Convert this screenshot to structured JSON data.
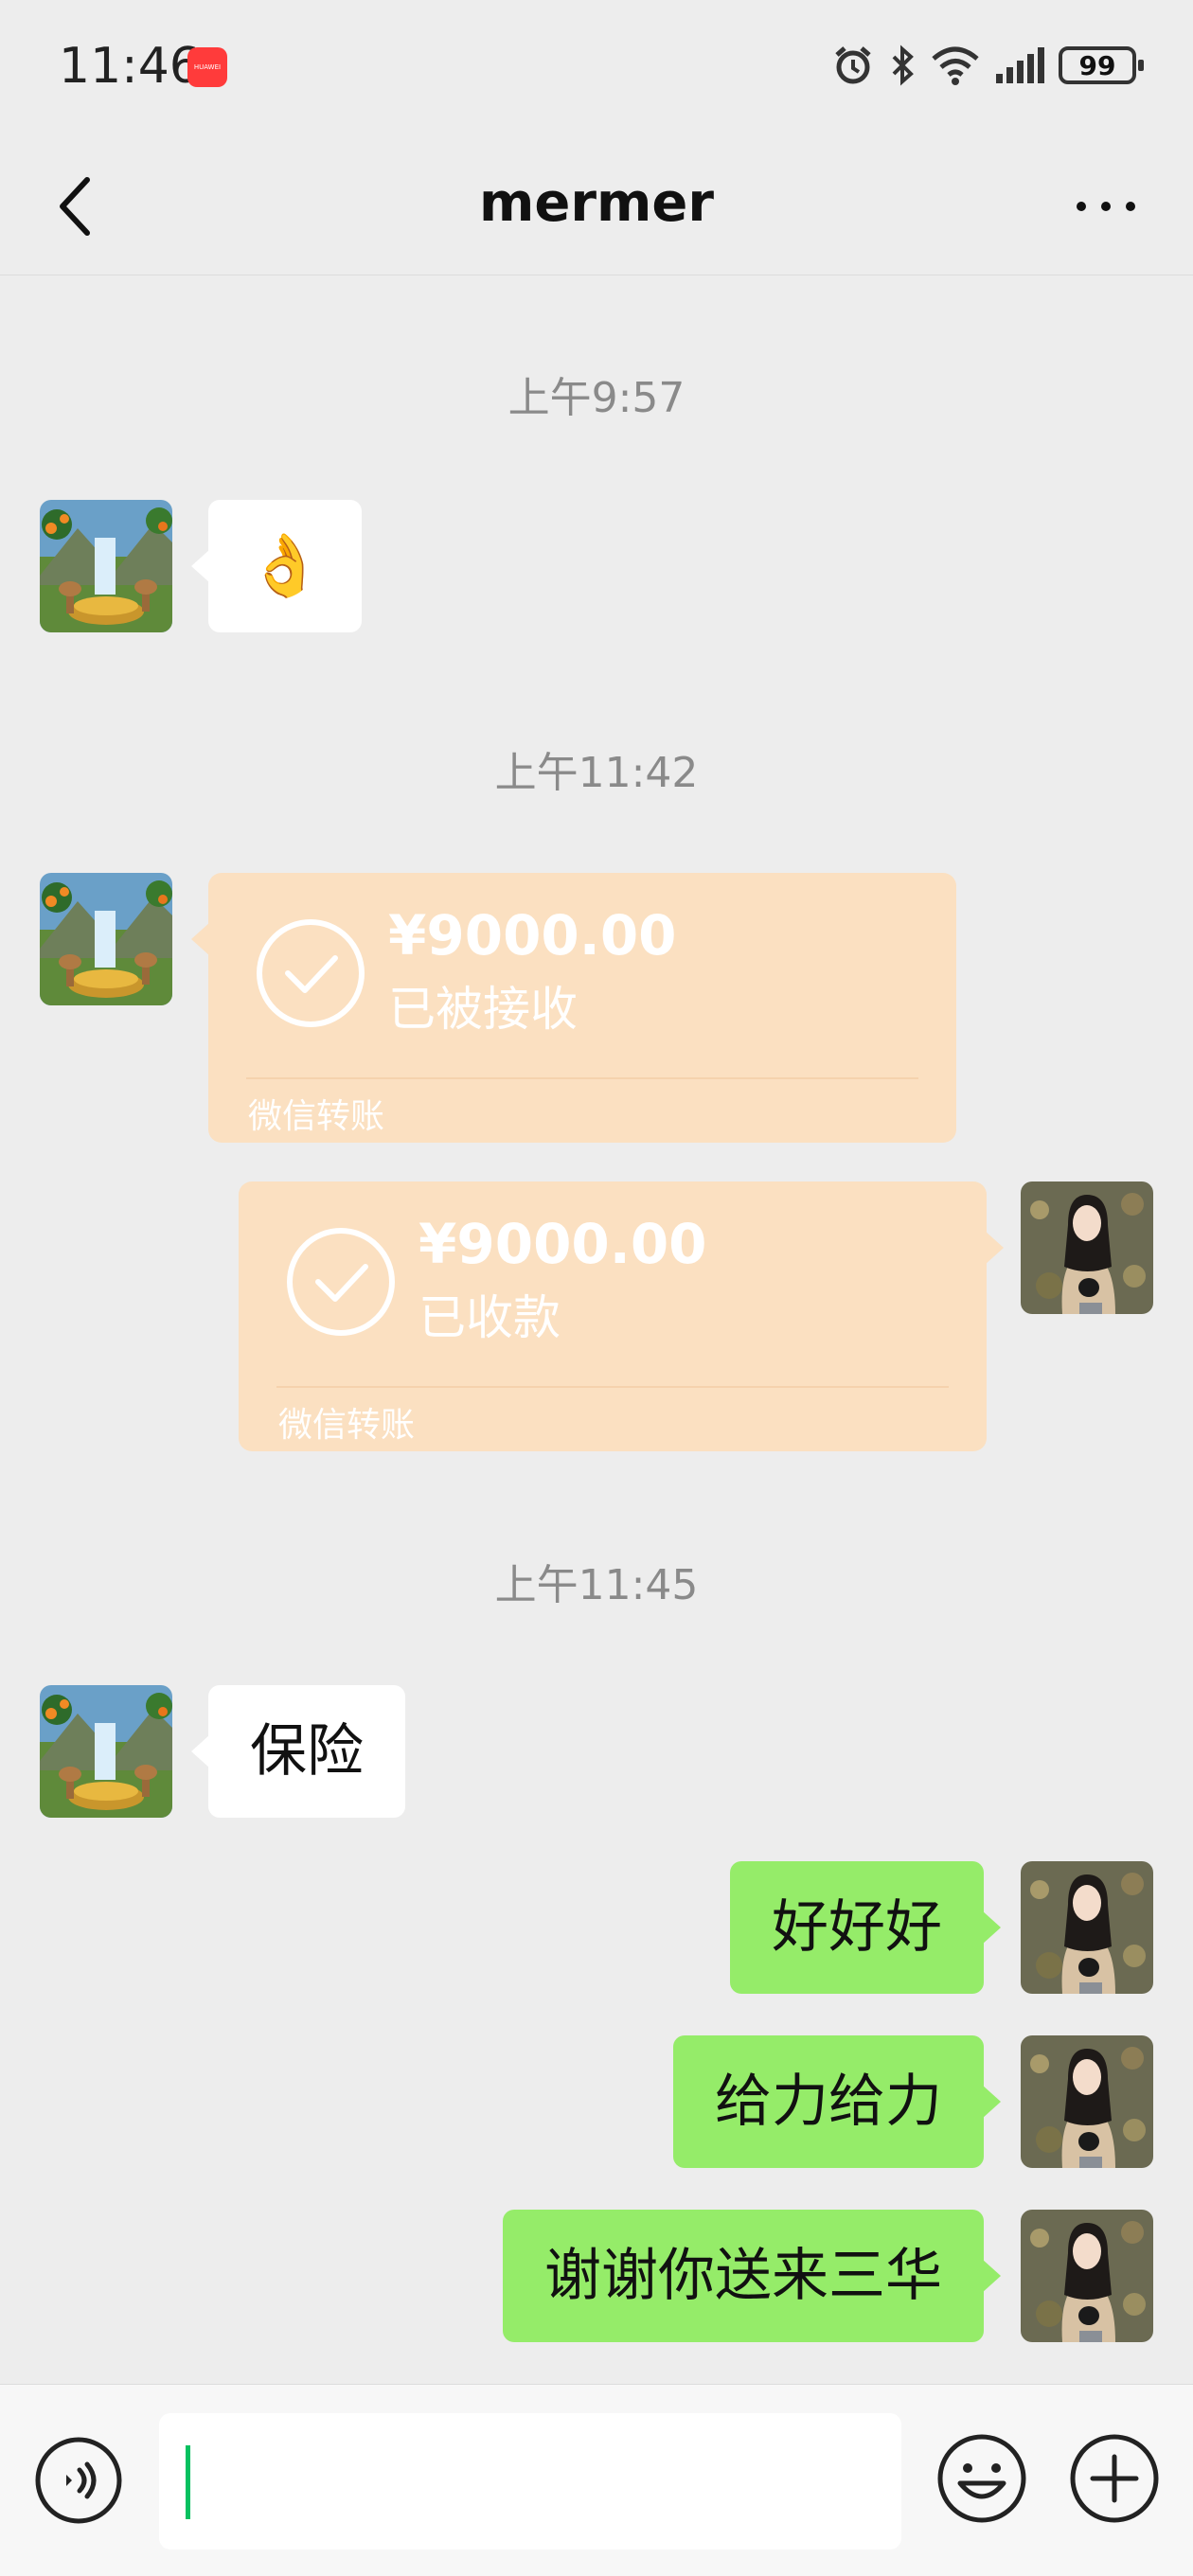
{
  "status_bar": {
    "time": "11:46",
    "app_badge": "HUAWEI",
    "battery": "99",
    "icons": [
      "alarm-icon",
      "bluetooth-icon",
      "wifi-icon",
      "signal-icon",
      "battery-icon"
    ]
  },
  "header": {
    "title": "mermer",
    "back_icon": "chevron-left-icon",
    "more_icon": "more-dots-icon"
  },
  "messages": {
    "ts1": "上午9:57",
    "ts2": "上午11:42",
    "ts3": "上午11:45",
    "emoji": "👌",
    "transfer1": {
      "amount": "¥9000.00",
      "status": "已被接收",
      "footer": "微信转账"
    },
    "transfer2": {
      "amount": "¥9000.00",
      "status": "已收款",
      "footer": "微信转账"
    },
    "baoxian": "保险",
    "msg1": "好好好",
    "msg2": "给力给力",
    "msg3": "谢谢你送来三华"
  },
  "input_bar": {
    "value": "",
    "icons": [
      "voice-icon",
      "emoji-icon",
      "plus-icon"
    ]
  },
  "colors": {
    "background": "#ededed",
    "sent_bubble": "#95ec69",
    "received_bubble": "#ffffff",
    "transfer_bubble": "#fbe0c1",
    "cursor": "#07c160"
  }
}
